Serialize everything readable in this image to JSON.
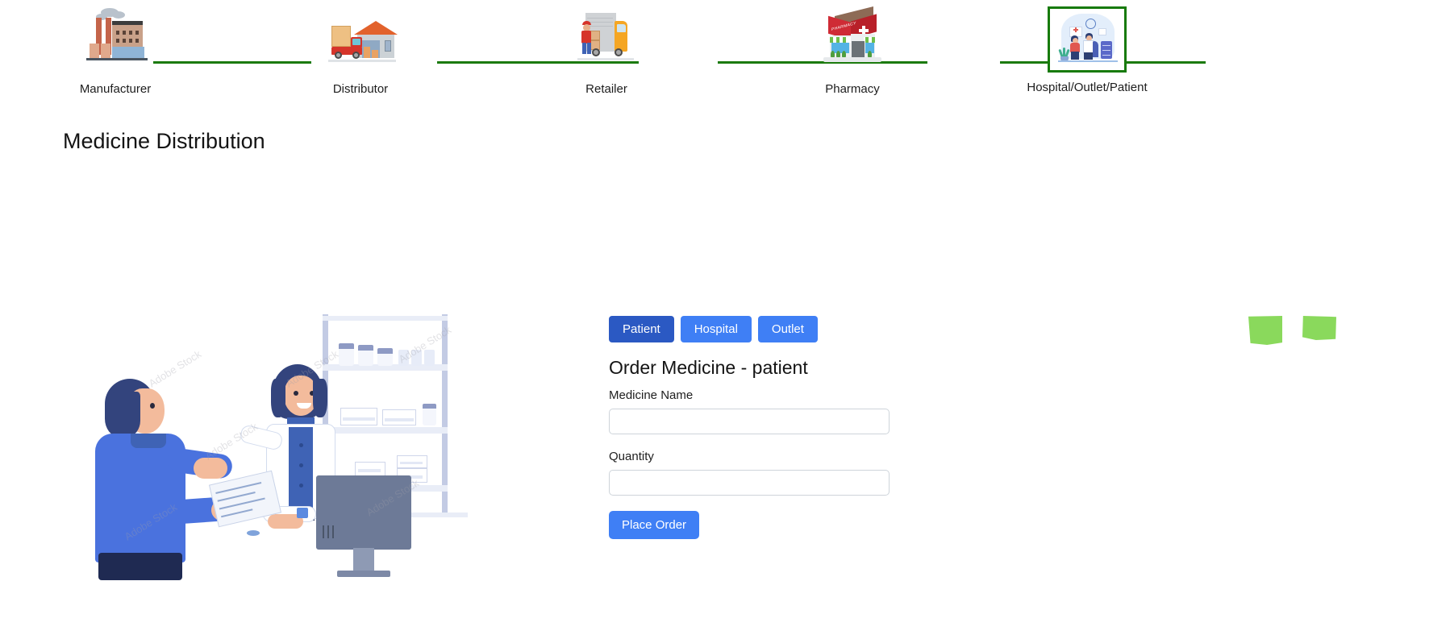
{
  "supply_chain": {
    "nodes": [
      {
        "label": "Manufacturer",
        "icon": "factory-icon",
        "active": false
      },
      {
        "label": "Distributor",
        "icon": "truck-warehouse-icon",
        "active": false
      },
      {
        "label": "Retailer",
        "icon": "delivery-van-icon",
        "active": false
      },
      {
        "label": "Pharmacy",
        "icon": "pharmacy-store-icon",
        "active": false
      },
      {
        "label": "Hospital/Outlet/Patient",
        "icon": "hospital-patient-icon",
        "active": true
      }
    ],
    "connector_color": "#1b7a0c",
    "active_border_color": "#177a0b"
  },
  "page": {
    "title": "Medicine Distribution"
  },
  "illustration": {
    "name": "pharmacist-customer-illustration",
    "watermark": "Adobe Stock"
  },
  "order_panel": {
    "tabs": [
      {
        "label": "Patient",
        "active": true
      },
      {
        "label": "Hospital",
        "active": false
      },
      {
        "label": "Outlet",
        "active": false
      }
    ],
    "heading": "Order Medicine - patient",
    "fields": [
      {
        "label": "Medicine Name",
        "value": "",
        "placeholder": ""
      },
      {
        "label": "Quantity",
        "value": "",
        "placeholder": ""
      }
    ],
    "submit_label": "Place Order",
    "accent_color": "#3f7ff5",
    "active_tab_color": "#2b59c3"
  },
  "placeholders": {
    "color": "#8ad95c",
    "items": [
      {
        "name": "broken-image-placeholder-1"
      },
      {
        "name": "broken-image-placeholder-2"
      }
    ]
  }
}
